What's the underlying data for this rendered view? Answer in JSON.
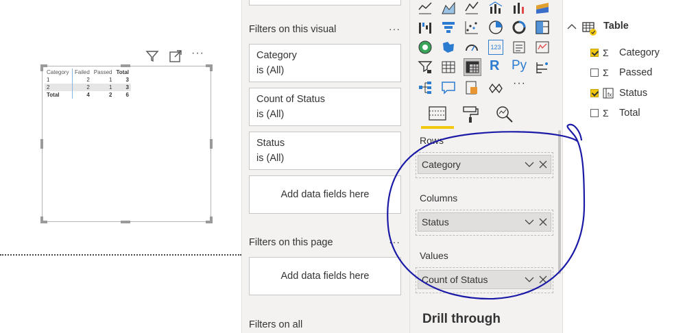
{
  "canvas": {
    "matrix": {
      "headers": [
        "Category",
        "Failed",
        "Passed",
        "Total"
      ],
      "rows": [
        [
          "1",
          "2",
          "1",
          "3"
        ],
        [
          "2",
          "2",
          "1",
          "3"
        ],
        [
          "Total",
          "4",
          "2",
          "6"
        ]
      ]
    },
    "header_icons": [
      "filter-icon",
      "focus-mode-icon",
      "more-options-icon"
    ],
    "more_label": "···"
  },
  "filters_pane": {
    "visual_section_title": "Filters on this visual",
    "page_section_title": "Filters on this page",
    "all_pages_partial": "Filters on all",
    "more": "···",
    "visual_filters": [
      {
        "name": "Category",
        "state": "is (All)"
      },
      {
        "name": "Count of Status",
        "state": "is (All)"
      },
      {
        "name": "Status",
        "state": "is (All)"
      }
    ],
    "add_fields_label": "Add data fields here",
    "add_fields_label_page": "Add data fields here"
  },
  "viz_pane": {
    "more": "···",
    "tab_icons": [
      "fields-tab-icon",
      "format-paintroller-icon",
      "analytics-magnifier-icon"
    ],
    "wells": [
      {
        "label": "Rows",
        "value": "Category"
      },
      {
        "label": "Columns",
        "value": "Status"
      },
      {
        "label": "Values",
        "value": "Count of Status"
      }
    ],
    "drill_through": "Drill through",
    "r_label": "R",
    "py_label": "Py",
    "num_label": "123",
    "accent": "#f2c80f",
    "annotation_color": "#1a1aa6"
  },
  "fields_pane": {
    "table_name": "Table",
    "fields": [
      {
        "name": "Category",
        "checked": true,
        "icon": "sigma-icon"
      },
      {
        "name": "Passed",
        "checked": false,
        "icon": "sigma-icon"
      },
      {
        "name": "Status",
        "checked": true,
        "icon": "calculated-column-icon"
      },
      {
        "name": "Total",
        "checked": false,
        "icon": "sigma-icon"
      }
    ],
    "sigma": "Σ"
  }
}
